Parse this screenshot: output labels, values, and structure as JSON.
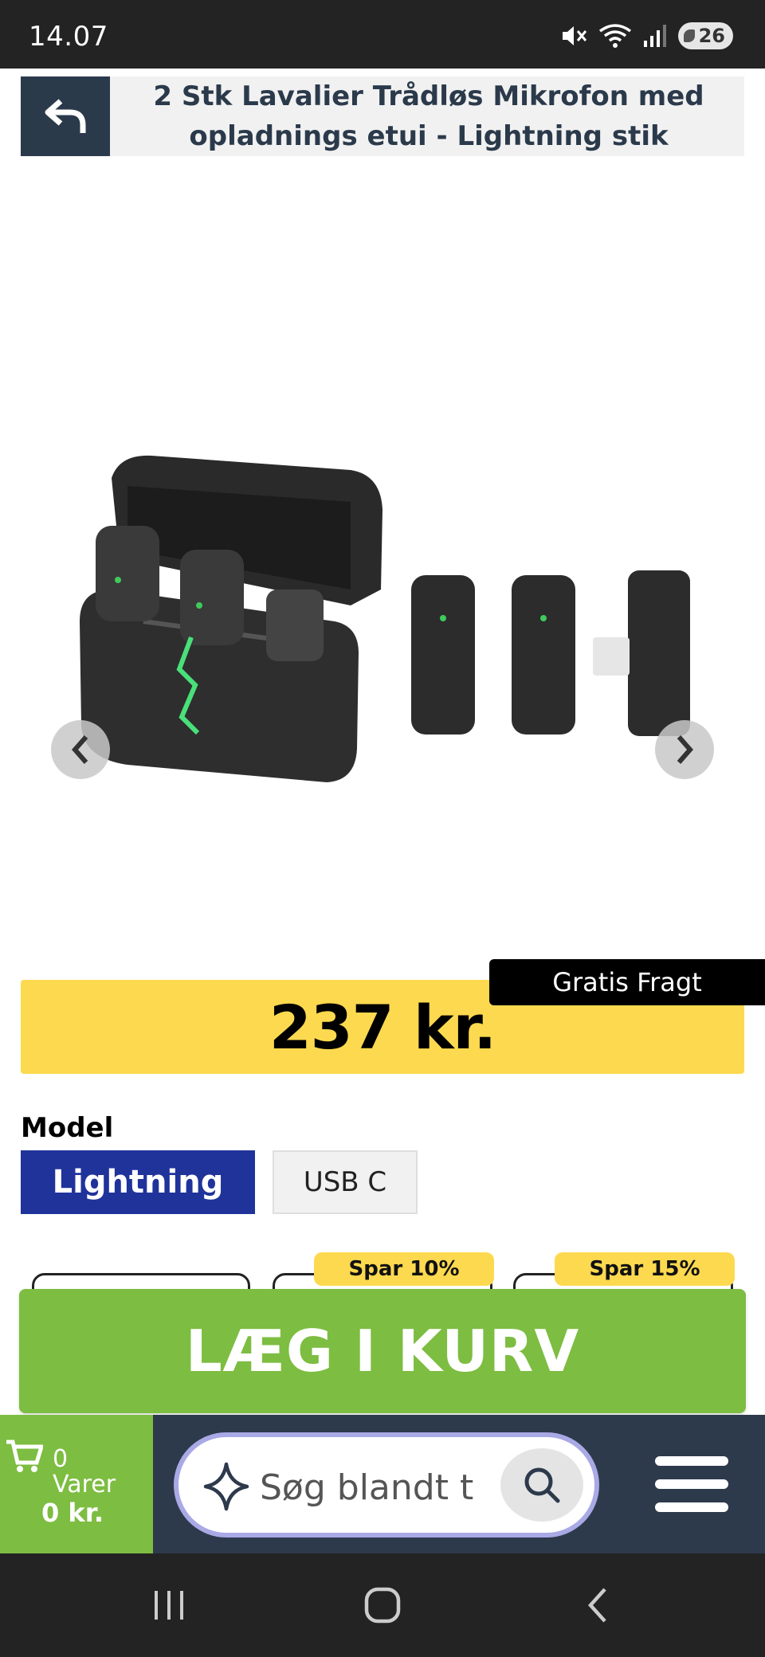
{
  "status": {
    "time": "14.07",
    "battery": "26"
  },
  "header": {
    "title": "2 Stk Lavalier Trådløs Mikrofon med opladnings etui - Lightning stik"
  },
  "product": {
    "price": "237 kr.",
    "shipping_badge": "Gratis Fragt",
    "model_label": "Model",
    "options": [
      {
        "label": "Lightning",
        "selected": true
      },
      {
        "label": "USB C",
        "selected": false
      }
    ],
    "bundles": [
      {
        "badge": ""
      },
      {
        "badge": "Spar 10%"
      },
      {
        "badge": "Spar 15%"
      }
    ],
    "add_to_cart": "LÆG I KURV"
  },
  "cart": {
    "count": "0",
    "items_label": "Varer",
    "total": "0 kr."
  },
  "search": {
    "placeholder": "Søg blandt tusindvis af produkter"
  },
  "colors": {
    "header_dark": "#2b3a4b",
    "price_yellow": "#fdd94f",
    "selected_blue": "#20339a",
    "cart_green": "#7dbd41",
    "search_border": "#a9a9e6"
  },
  "icons": [
    "back-arrow-icon",
    "chevron-left-icon",
    "chevron-right-icon",
    "cart-icon",
    "sparkle-icon",
    "search-icon",
    "menu-icon",
    "recents-icon",
    "home-icon",
    "back-icon",
    "mute-icon",
    "wifi-icon",
    "signal-icon",
    "battery-icon"
  ]
}
